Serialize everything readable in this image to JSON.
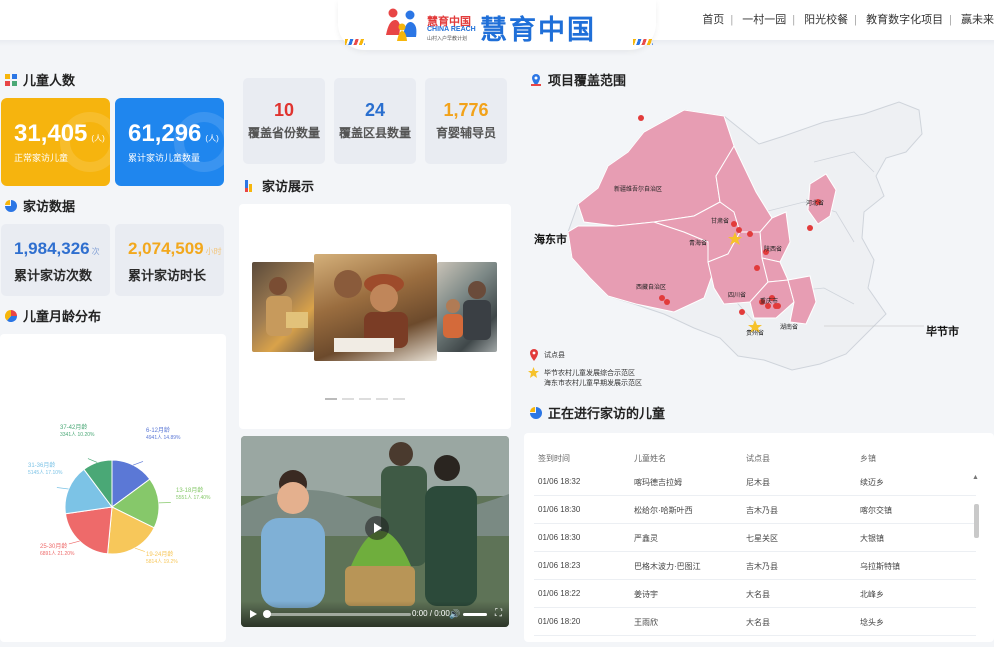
{
  "header": {
    "logo_cn_small": "慧育中国",
    "logo_en": "CHINA REACH",
    "logo_sub": "山村入户早教计划",
    "logo_big": "慧育中国",
    "nav": [
      "首页",
      "一村一园",
      "阳光校餐",
      "教育数字化项目",
      "赢未来"
    ]
  },
  "children_count": {
    "title": "儿童人数",
    "cards": [
      {
        "value": "31,405",
        "unit": "(人)",
        "label": "正常家访儿童",
        "color": "#f6b40e"
      },
      {
        "value": "61,296",
        "unit": "(人)",
        "label": "累计家访儿童数量",
        "color": "#1f86ee"
      }
    ]
  },
  "visit_data": {
    "title": "家访数据",
    "cards": [
      {
        "value": "1,984,326",
        "unit": "次",
        "label": "累计家访次数",
        "color": "#2f6fcf"
      },
      {
        "value": "2,074,509",
        "unit": "小时",
        "label": "累计家访时长",
        "color": "#f2a81d"
      }
    ]
  },
  "coverage_stats": [
    {
      "value": "10",
      "label": "覆盖省份数量",
      "color": "#e0332f"
    },
    {
      "value": "24",
      "label": "覆盖区县数量",
      "color": "#2a6fcf"
    },
    {
      "value": "1,776",
      "label": "育婴辅导员",
      "color": "#f2a21a"
    }
  ],
  "home_visit_show": {
    "title": "家访展示"
  },
  "age_distribution": {
    "title": "儿童月龄分布"
  },
  "chart_data": {
    "type": "pie",
    "categories": [
      "6-12月龄",
      "13-18月龄",
      "19-24月龄",
      "25-30月龄",
      "31-36月龄",
      "37-42月龄"
    ],
    "values": [
      14.89,
      17.4,
      19.2,
      21.2,
      17.1,
      10.2
    ],
    "labels": [
      {
        "name": "6-12月龄",
        "detail": "4941人 14.89%"
      },
      {
        "name": "13-18月龄",
        "detail": "5551人 17.40%"
      },
      {
        "name": "19-24月龄",
        "detail": "5814人 19.2%"
      },
      {
        "name": "25-30月龄",
        "detail": "6891人 21.20%"
      },
      {
        "name": "31-36月龄",
        "detail": "5145人 17.10%"
      },
      {
        "name": "37-42月龄",
        "detail": "3341人 10.20%"
      }
    ],
    "colors": [
      "#5b78d6",
      "#86c86a",
      "#f7c75a",
      "#ee6a6a",
      "#7cc3e6",
      "#4aa876"
    ]
  },
  "map_section": {
    "title": "项目覆盖范围",
    "city_left": "海东市",
    "city_right": "毕节市",
    "regions": [
      "新疆维吾尔自治区",
      "甘肃省",
      "青海省",
      "河北省",
      "陕西省",
      "西藏自治区",
      "四川省",
      "重庆市",
      "湖南省",
      "贵州省"
    ],
    "legend": [
      {
        "icon": "pin",
        "label": "试点县"
      },
      {
        "icon": "star",
        "label": "毕节农村儿童发展综合示范区"
      },
      {
        "icon": "none",
        "label": "海东市农村儿童早期发展示范区"
      }
    ]
  },
  "video": {
    "time": "0:00 / 0:00"
  },
  "visiting_table": {
    "title": "正在进行家访的儿童",
    "headers": [
      "签到时间",
      "儿童姓名",
      "试点县",
      "乡镇"
    ],
    "rows": [
      [
        "01/06 18:32",
        "喀玛德吉拉姆",
        "尼木县",
        "续迈乡"
      ],
      [
        "01/06 18:30",
        "松给尔·哈斯叶西",
        "吉木乃县",
        "喀尔交镇"
      ],
      [
        "01/06 18:30",
        "严鑫灵",
        "七星关区",
        "大银镇"
      ],
      [
        "01/06 18:23",
        "巴格木波力·巴图江",
        "吉木乃县",
        "乌拉斯特镇"
      ],
      [
        "01/06 18:22",
        "姜诗宇",
        "大名县",
        "北峰乡"
      ],
      [
        "01/06 18:20",
        "王雨欣",
        "大名县",
        "埝头乡"
      ]
    ]
  }
}
